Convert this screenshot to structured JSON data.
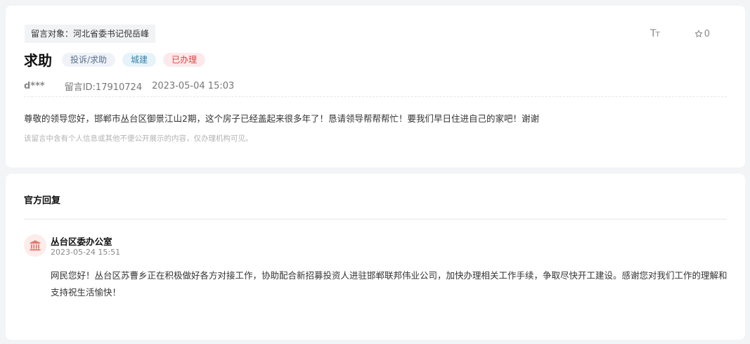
{
  "message": {
    "recipient": "留言对象：河北省委书记倪岳峰",
    "font_size_label_big": "T",
    "font_size_label_small": "T",
    "favorite_count": "0",
    "title": "求助",
    "tags": {
      "type": "投诉/求助",
      "domain": "城建",
      "status": "已办理"
    },
    "author": "d***",
    "message_id": "留言ID:17910724",
    "time": "2023-05-04 15:03",
    "content": "尊敬的领导您好，邯郸市丛台区御景江山2期，这个房子已经盖起来很多年了！恳请领导帮帮帮忙！要我们早日住进自己的家吧！谢谢",
    "privacy_note": "该留言中含有个人信息或其他不便公开展示的内容，仅办理机构可见。"
  },
  "reply": {
    "heading": "官方回复",
    "department": "丛台区委办公室",
    "time": "2023-05-24 15:51",
    "content": "网民您好！丛台区苏曹乡正在积极做好各方对接工作，协助配合新招募投资人进驻邯郸联邦伟业公司，加快办理相关工作手续，争取尽快开工建设。感谢您对我们工作的理解和支持祝生活愉快！"
  },
  "colors": {
    "status_red": "#d8433d",
    "domain_blue": "#3a83a8",
    "avatar_red": "#e07a70"
  }
}
